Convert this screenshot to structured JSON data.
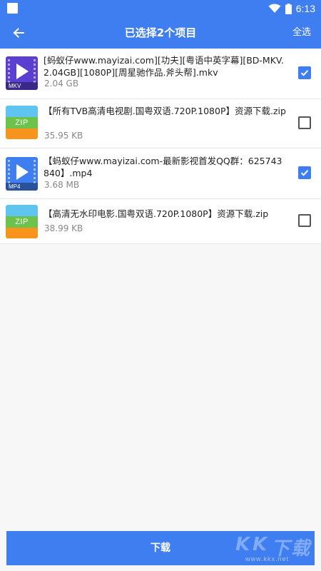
{
  "status_bar": {
    "time": "6:13",
    "icons": [
      "app-notification-icon",
      "wifi-icon",
      "battery-icon"
    ],
    "background": "#3f7ef0"
  },
  "app_bar": {
    "title": "已选择2个项目",
    "select_all_label": "全选",
    "back_icon": "arrow-left-icon",
    "background": "#3f7ef0"
  },
  "files": [
    {
      "name": "[蚂蚁仔www.mayizai.com][功夫][粤语中英字幕][BD-MKV.2.04GB][1080P][周星驰作品.斧头帮].mkv",
      "size": "2.04 GB",
      "type": "video",
      "ext_label": "MKV",
      "checked": true
    },
    {
      "name": "【所有TVB高清电视剧.国粤双语.720P.1080P】资源下载.zip",
      "size": "35.95 KB",
      "type": "zip",
      "ext_label": "ZIP",
      "checked": false
    },
    {
      "name": "【蚂蚁仔www.mayizai.com-最新影视首发QQ群：625743840】.mp4",
      "size": "3.68 MB",
      "type": "video",
      "ext_label": "MP4",
      "checked": true
    },
    {
      "name": "【高清无水印电影.国粤双语.720P.1080P】资源下载.zip",
      "size": "38.99 KB",
      "type": "zip",
      "ext_label": "ZIP",
      "checked": false
    }
  ],
  "download_button_label": "下载",
  "watermark": {
    "logo_text": "KK下载",
    "url": "www.kkx.net"
  },
  "colors": {
    "accent": "#3f7ef0",
    "mkv_thumb": "#5b3fd0",
    "zip_blue": "#5fc4f0",
    "zip_green": "#6cc24a",
    "zip_orange": "#f7941d"
  }
}
